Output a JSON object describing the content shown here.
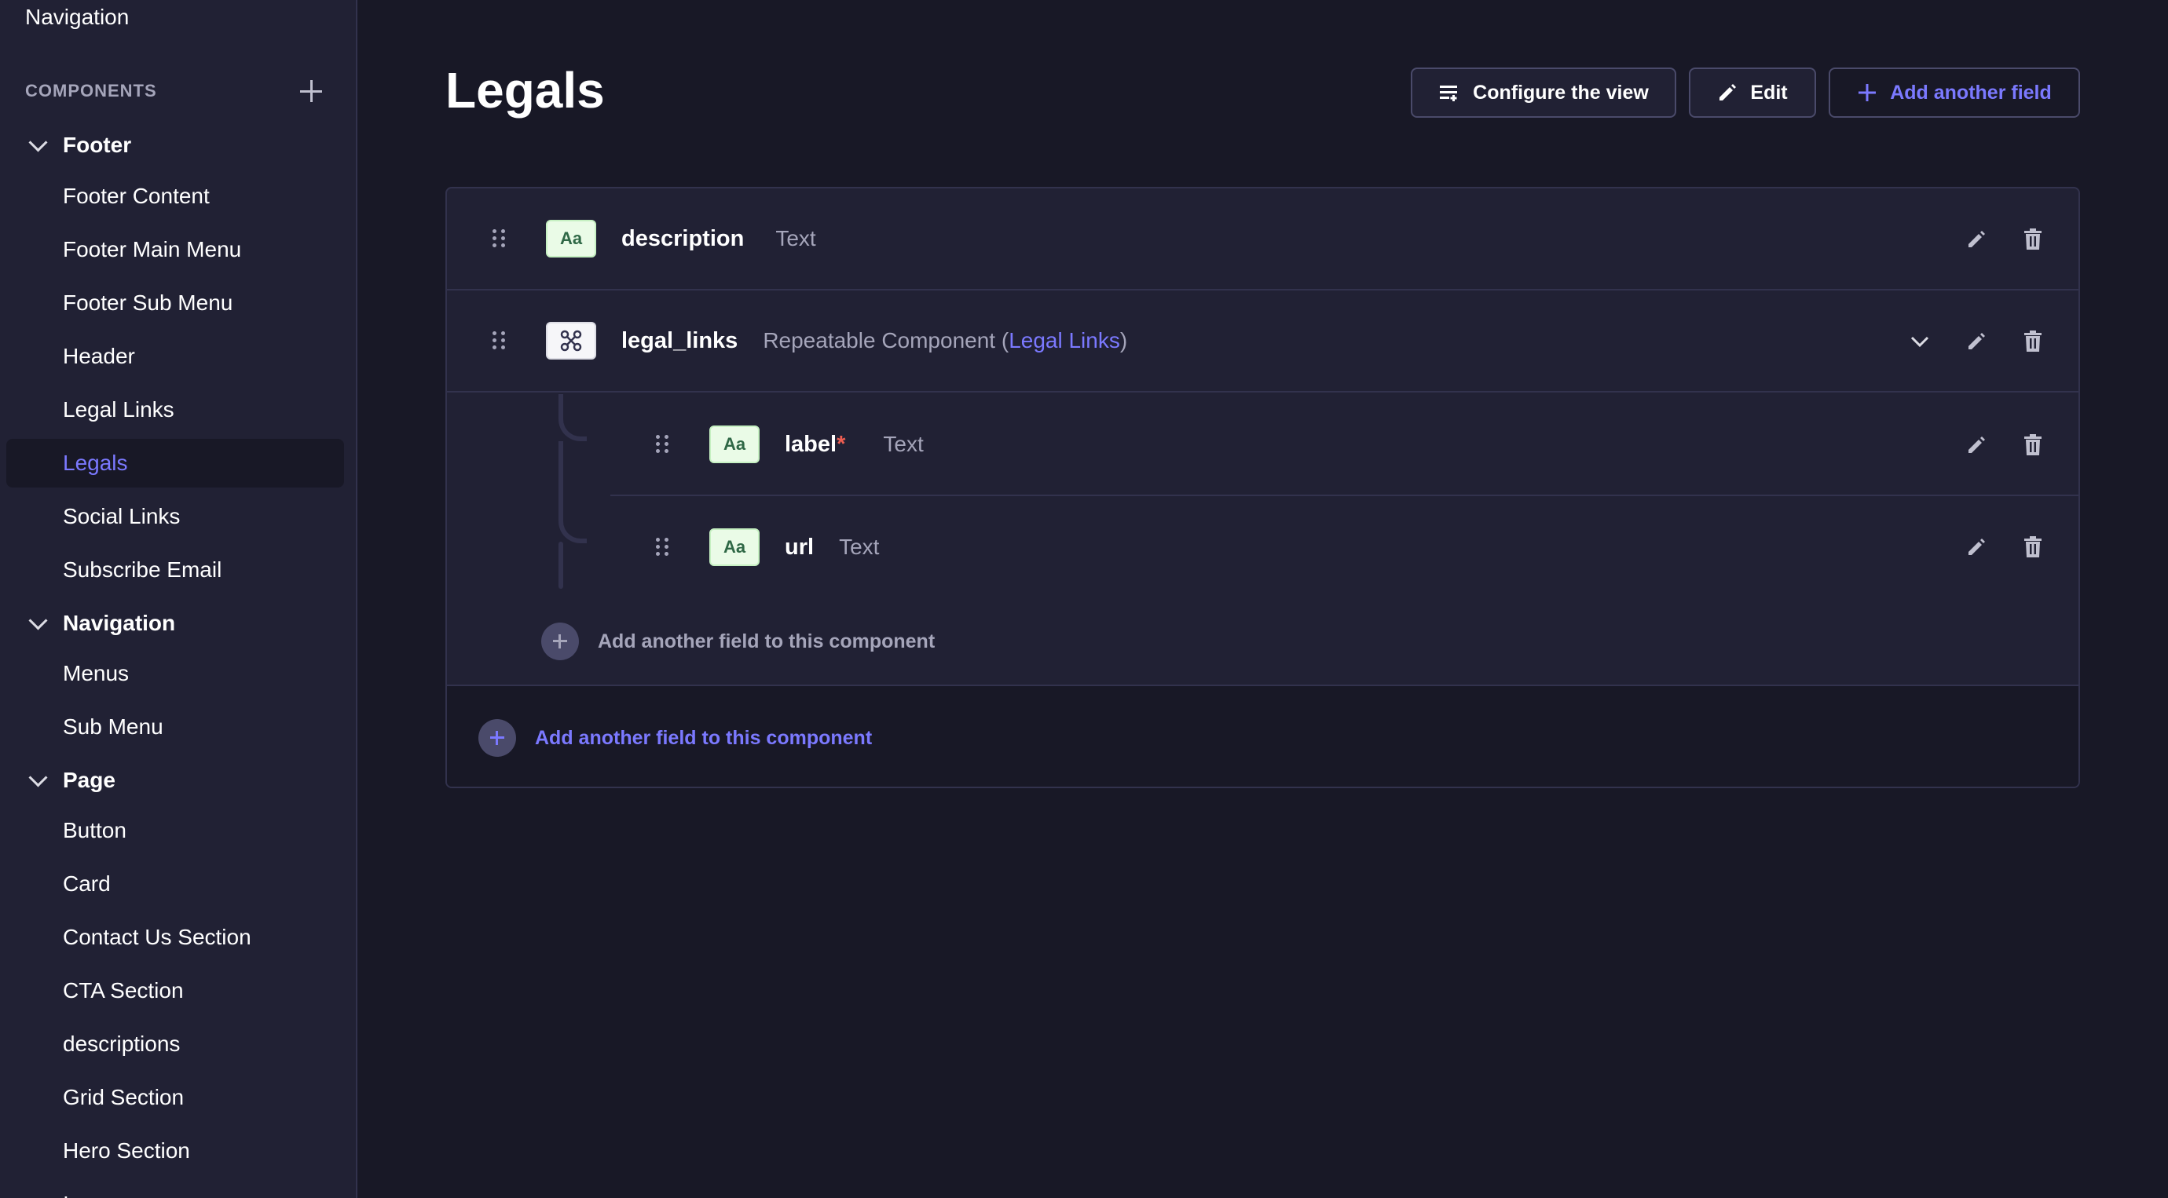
{
  "sidebar": {
    "top_item": "Navigation",
    "components_label": "COMPONENTS",
    "groups": [
      {
        "label": "Footer",
        "items": [
          "Footer Content",
          "Footer Main Menu",
          "Footer Sub Menu",
          "Header",
          "Legal Links",
          "Legals",
          "Social Links",
          "Subscribe Email"
        ]
      },
      {
        "label": "Navigation",
        "items": [
          "Menus",
          "Sub Menu"
        ]
      },
      {
        "label": "Page",
        "items": [
          "Button",
          "Card",
          "Contact Us Section",
          "CTA Section",
          "descriptions",
          "Grid Section",
          "Hero Section",
          "I"
        ]
      }
    ],
    "active_item": "Legals"
  },
  "header": {
    "title": "Legals",
    "configure_label": "Configure the view",
    "edit_label": "Edit",
    "add_field_label": "Add another field"
  },
  "fields": [
    {
      "name": "description",
      "type": "Text",
      "badge": "Aa"
    },
    {
      "name": "legal_links",
      "type_prefix": "Repeatable Component (",
      "type_link": "Legal Links",
      "type_suffix": ")",
      "badge": "component"
    }
  ],
  "nested_fields": [
    {
      "name": "label",
      "required_mark": "*",
      "type": "Text",
      "badge": "Aa"
    },
    {
      "name": "url",
      "type": "Text",
      "badge": "Aa"
    }
  ],
  "add_to_component_label": "Add another field to this component",
  "add_to_component_outer_label": "Add another field to this component",
  "colors": {
    "accent": "#7b79ff",
    "background": "#181826",
    "panel": "#212134",
    "required": "#ee5e52"
  },
  "icons": [
    "plus-icon",
    "chevron-down-icon",
    "drag-handle-icon",
    "pencil-icon",
    "trash-icon",
    "list-settings-icon",
    "component-icon"
  ]
}
